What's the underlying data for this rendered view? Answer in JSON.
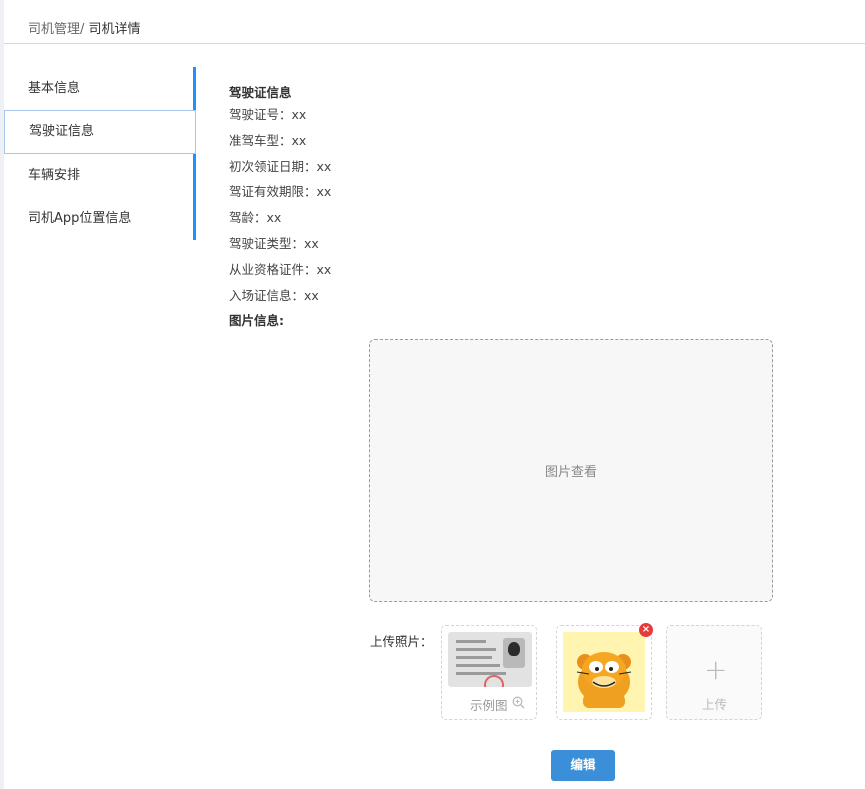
{
  "breadcrumb": {
    "parent": "司机管理/",
    "current": "司机详情"
  },
  "sidebar": {
    "items": [
      {
        "label": "基本信息"
      },
      {
        "label": "驾驶证信息"
      },
      {
        "label": "车辆安排"
      },
      {
        "label": "司机App位置信息"
      }
    ],
    "active_index": 1,
    "accent_color": "#1e90ff"
  },
  "license": {
    "section_title": "驾驶证信息",
    "fields": [
      {
        "label": "驾驶证号：",
        "value": "xx"
      },
      {
        "label": "准驾车型：",
        "value": "xx"
      },
      {
        "label": "初次领证日期：",
        "value": "xx"
      },
      {
        "label": "驾证有效期限：",
        "value": "xx"
      },
      {
        "label": "驾龄：",
        "value": "xx"
      },
      {
        "label": "驾驶证类型：",
        "value": "xx"
      },
      {
        "label": "从业资格证件：",
        "value": "xx"
      },
      {
        "label": "入场证信息：",
        "value": "xx"
      }
    ]
  },
  "pictures": {
    "section_title": "图片信息:",
    "viewer_placeholder": "图片查看",
    "upload_label": "上传照片：",
    "sample_caption": "示例图",
    "add_caption": "上传",
    "remove_icon": "×"
  },
  "actions": {
    "edit_label": "编辑",
    "edit_color": "#3a8fd8"
  }
}
